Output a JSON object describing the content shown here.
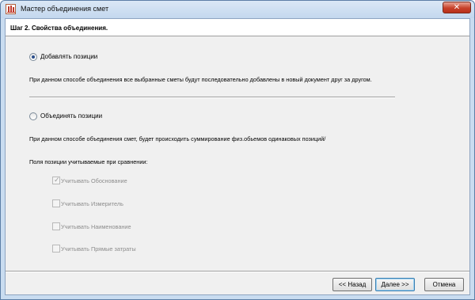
{
  "window": {
    "title": "Мастер объединения смет",
    "close_glyph": "✕"
  },
  "step_title": "Шаг 2. Свойства объединения.",
  "options": {
    "append": {
      "label": "Добавлять позиции",
      "selected": true,
      "description": "При данном способе объединения все выбранные сметы будут последовательно добавлены в новый документ друг за другом."
    },
    "merge": {
      "label": "Объединять позиции",
      "selected": false,
      "description": "При данном способе объединения смет, будет происходить суммирование физ.обьемов одинаковых позиций/"
    }
  },
  "compare_fields_label": "Поля позиции учитываемые при сравнении:",
  "compare_fields": [
    {
      "label": "Учитывать Обоснование",
      "checked": true,
      "enabled": false
    },
    {
      "label": "Учитывать Измеритель",
      "checked": false,
      "enabled": false
    },
    {
      "label": "Учитывать Наименование",
      "checked": false,
      "enabled": false
    },
    {
      "label": "Учитывать Прямые затраты",
      "checked": false,
      "enabled": false
    }
  ],
  "buttons": {
    "back": "<< Назад",
    "next": "Далее >>",
    "cancel": "Отмена"
  },
  "icons": {
    "app": "estimate-app-icon"
  }
}
